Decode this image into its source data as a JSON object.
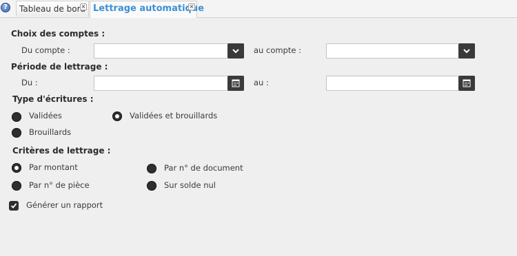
{
  "tabs": [
    {
      "label": "Tableau de bord",
      "close_glyph": "×"
    },
    {
      "label": "Lettrage automatique",
      "close_glyph": "×"
    }
  ],
  "help_glyph": "?",
  "comptes": {
    "title": "Choix des comptes :",
    "from_label": "Du compte :",
    "from_value": "",
    "to_label": "au compte :",
    "to_value": ""
  },
  "periode": {
    "title": "Période de lettrage :",
    "from_label": "Du :",
    "from_value": "",
    "to_label": "au :",
    "to_value": ""
  },
  "type_ecritures": {
    "title": "Type d'écritures :",
    "options": [
      {
        "label": "Validées",
        "checked": false
      },
      {
        "label": "Validées et brouillards",
        "checked": true
      },
      {
        "label": "Brouillards",
        "checked": false
      }
    ]
  },
  "criteres": {
    "title": "Critères de lettrage :",
    "options": [
      {
        "label": "Par montant",
        "checked": true
      },
      {
        "label": "Par n° de document",
        "checked": false
      },
      {
        "label": "Par n° de pièce",
        "checked": false
      },
      {
        "label": "Sur solde nul",
        "checked": false
      }
    ]
  },
  "rapport": {
    "label": "Générer un rapport",
    "checked": true
  },
  "icons": {
    "dropdown": "chevron-down-icon",
    "calendar": "calendar-icon",
    "help": "help-icon",
    "close": "close-icon",
    "check": "check-icon"
  }
}
